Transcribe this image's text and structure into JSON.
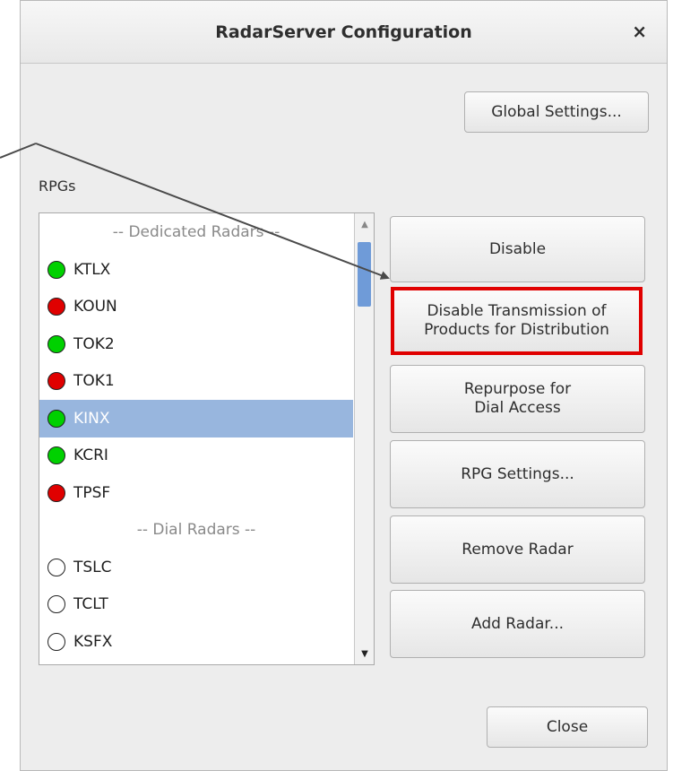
{
  "window": {
    "title": "RadarServer Configuration",
    "close_glyph": "×"
  },
  "global_settings_label": "Global Settings...",
  "rpgs_label": "RPGs",
  "list": {
    "rows": [
      {
        "type": "header",
        "label": "-- Dedicated Radars --"
      },
      {
        "type": "radar",
        "label": "KTLX",
        "status": "green"
      },
      {
        "type": "radar",
        "label": "KOUN",
        "status": "red"
      },
      {
        "type": "radar",
        "label": "TOK2",
        "status": "green"
      },
      {
        "type": "radar",
        "label": "TOK1",
        "status": "red"
      },
      {
        "type": "radar",
        "label": "KINX",
        "status": "green",
        "selected": true
      },
      {
        "type": "radar",
        "label": "KCRI",
        "status": "green"
      },
      {
        "type": "radar",
        "label": "TPSF",
        "status": "red"
      },
      {
        "type": "header",
        "label": "-- Dial Radars --"
      },
      {
        "type": "radar",
        "label": "TSLC",
        "status": "empty"
      },
      {
        "type": "radar",
        "label": "TCLT",
        "status": "empty"
      },
      {
        "type": "radar",
        "label": "KSFX",
        "status": "empty"
      }
    ]
  },
  "actions": {
    "disable": "Disable",
    "disable_transmission_line1": "Disable Transmission of",
    "disable_transmission_line2": "Products for Distribution",
    "repurpose_line1": "Repurpose for",
    "repurpose_line2": "Dial Access",
    "rpg_settings": "RPG Settings...",
    "remove_radar": "Remove Radar",
    "add_radar": "Add Radar..."
  },
  "close_label": "Close",
  "colors": {
    "status_green": "#00d100",
    "status_red": "#e00000",
    "selection": "#98b6de",
    "highlight_border": "#e00000"
  },
  "icons": {
    "status": "circle",
    "close": "x-icon",
    "scroll_up": "triangle-up-icon",
    "scroll_down": "triangle-down-icon"
  }
}
